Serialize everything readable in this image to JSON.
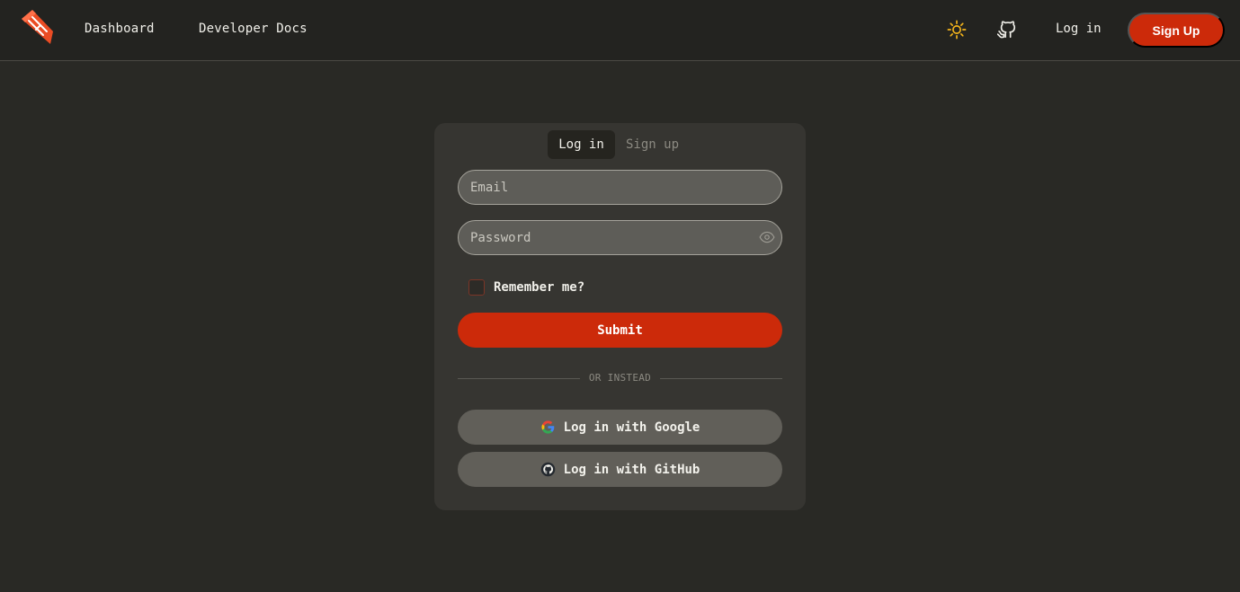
{
  "nav": {
    "links": [
      {
        "label": "Dashboard"
      },
      {
        "label": "Developer Docs"
      }
    ],
    "login_label": "Log in",
    "signup_label": "Sign Up",
    "icons": [
      "logo-icon",
      "sun-icon",
      "github-icon"
    ]
  },
  "auth": {
    "tabs": [
      {
        "label": "Log in",
        "active": true
      },
      {
        "label": "Sign up",
        "active": false
      }
    ],
    "email_placeholder": "Email",
    "password_placeholder": "Password",
    "remember_label": "Remember me?",
    "remember_checked": false,
    "submit_label": "Submit",
    "divider_text": "OR INSTEAD",
    "google_label": "Log in with Google",
    "github_label": "Log in with GitHub"
  },
  "colors": {
    "accent": "#cc2a0a",
    "background": "#292925",
    "card": "#363531",
    "sun": "#f5b51b"
  }
}
